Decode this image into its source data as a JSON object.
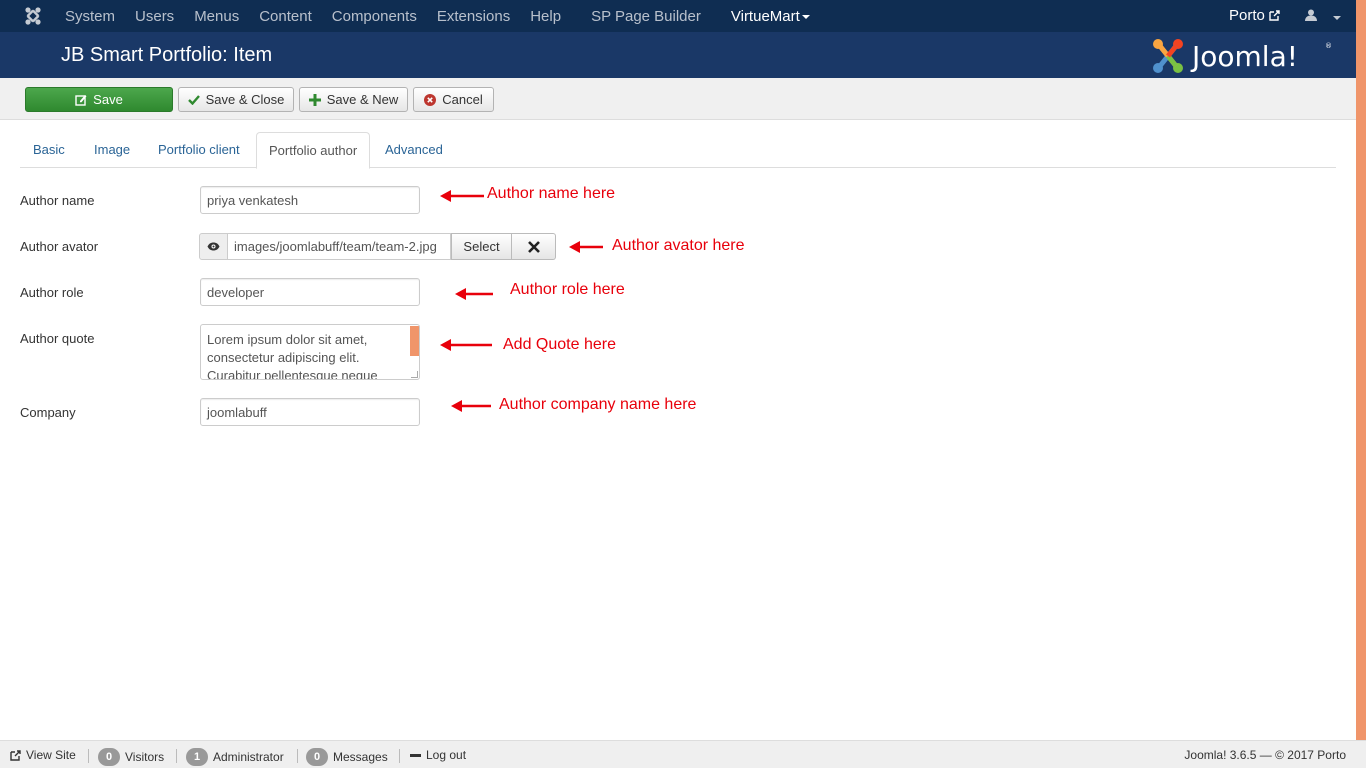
{
  "navbar": {
    "menu": [
      "System",
      "Users",
      "Menus",
      "Content",
      "Components",
      "Extensions",
      "Help",
      "SP Page Builder"
    ],
    "virtuemart": "VirtueMart",
    "site_name": "Porto"
  },
  "header": {
    "title": "JB Smart Portfolio: Item"
  },
  "toolbar": {
    "save": "Save",
    "save_close": "Save & Close",
    "save_new": "Save & New",
    "cancel": "Cancel"
  },
  "tabs": [
    "Basic",
    "Image",
    "Portfolio client",
    "Portfolio author",
    "Advanced"
  ],
  "active_tab": "Portfolio author",
  "form": {
    "author_name": {
      "label": "Author name",
      "value": "priya venkatesh"
    },
    "author_avatar": {
      "label": "Author avator",
      "value": "images/joomlabuff/team/team-2.jpg",
      "select": "Select"
    },
    "author_role": {
      "label": "Author role",
      "value": "developer"
    },
    "author_quote": {
      "label": "Author quote",
      "value": "Lorem ipsum dolor sit amet, consectetur adipiscing elit. Curabitur pellentesque neque"
    },
    "company": {
      "label": "Company",
      "value": "joomlabuff"
    }
  },
  "annotations": {
    "name": "Author name here",
    "avatar": "Author avator here",
    "role": "Author role here",
    "quote": "Add Quote here",
    "company": "Author company name here"
  },
  "statusbar": {
    "view_site": "View Site",
    "visitors_count": "0",
    "visitors": "Visitors",
    "admin_count": "1",
    "admin": "Administrator",
    "messages_count": "0",
    "messages": "Messages",
    "logout": "Log out",
    "version": "Joomla! 3.6.5 — © 2017 Porto"
  },
  "colors": {
    "navbar": "#0f2d52",
    "header": "#1a3867",
    "save_green": "#3c9a3c",
    "annotation_red": "#e8000b",
    "scroll_accent": "#f0956a"
  }
}
